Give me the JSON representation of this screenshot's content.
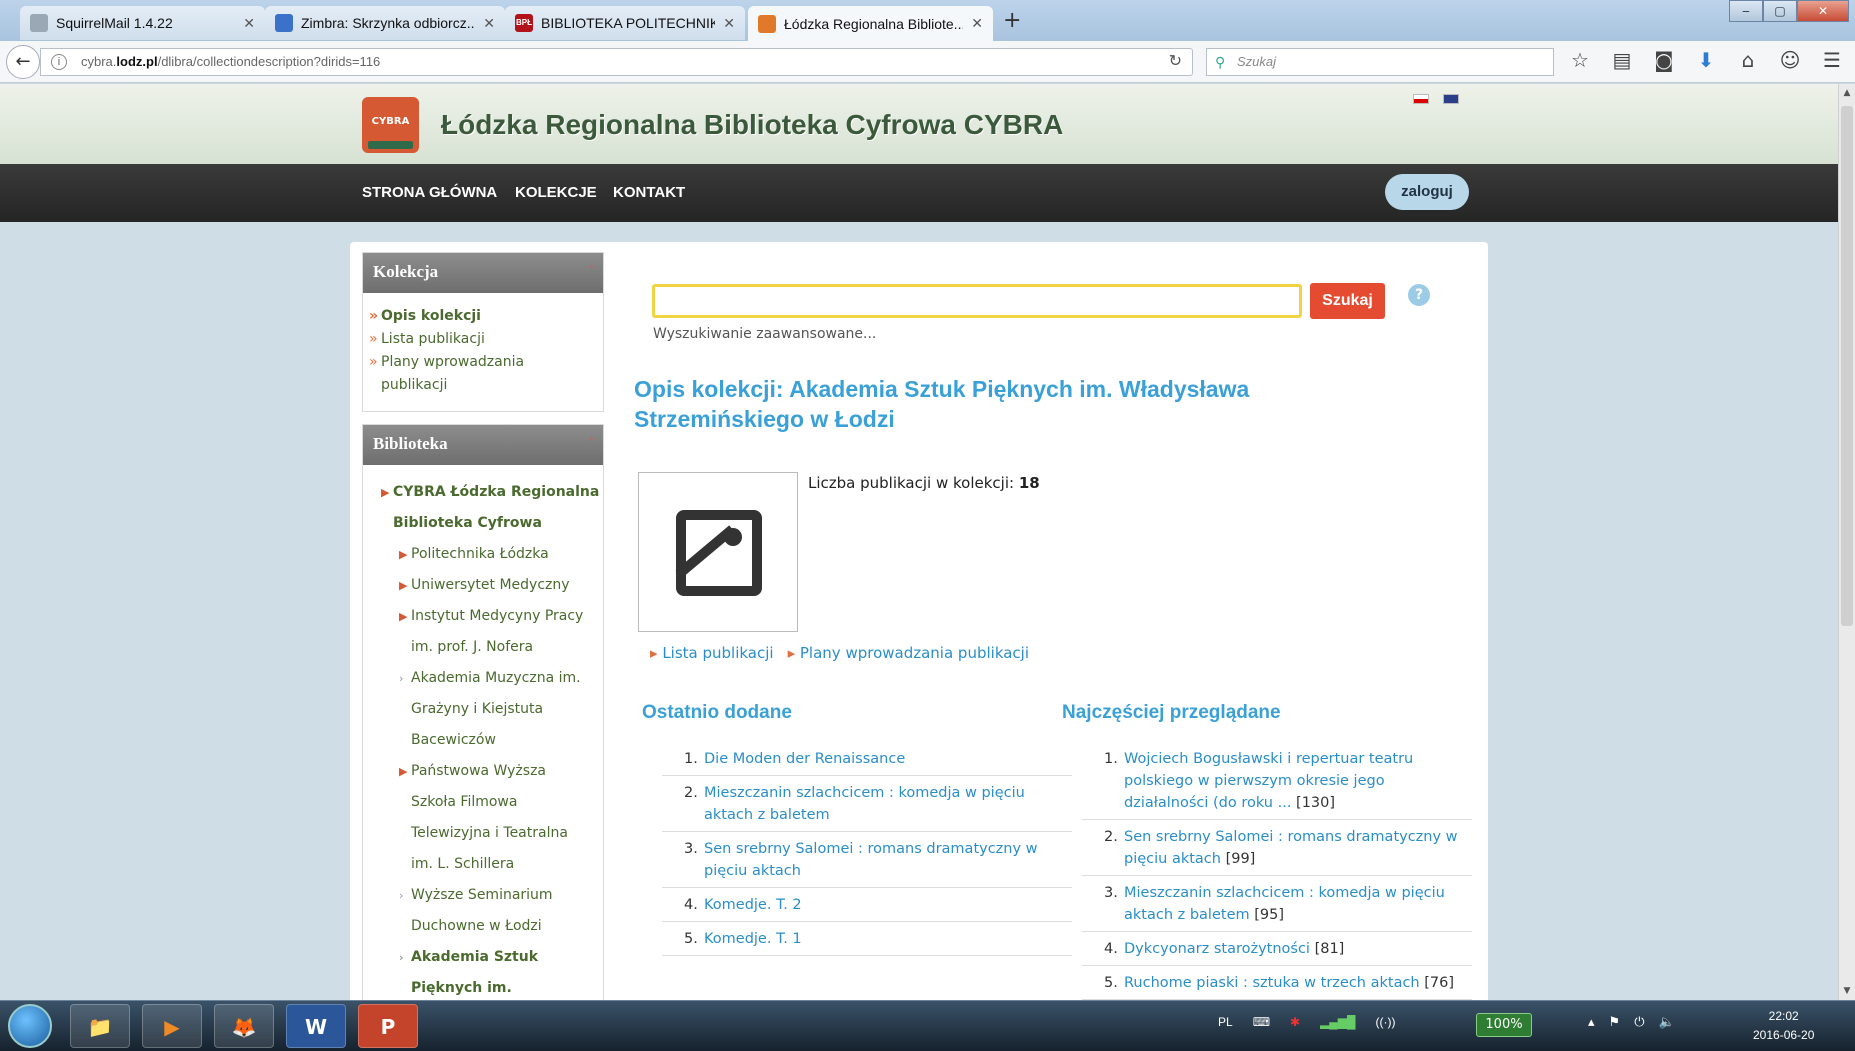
{
  "browser": {
    "tabs": [
      {
        "label": "SquirrelMail 1.4.22",
        "fav_color": "#9aa8b6"
      },
      {
        "label": "Zimbra: Skrzynka odbiorcz...",
        "fav_color": "#3a72c9"
      },
      {
        "label": "BIBLIOTEKA POLITECHNIKI...",
        "fav_color": "#b2121a",
        "fav_text": "BPŁ"
      },
      {
        "label": "Łódzka Regionalna Bibliote...",
        "fav_color": "#e07a2a"
      }
    ],
    "url_prefix": "cybra.",
    "url_domain": "lodz.pl",
    "url_path": "/dlibra/collectiondescription?dirids=116",
    "search_placeholder": "Szukaj",
    "window_buttons": [
      "‒",
      "▢",
      "✕"
    ]
  },
  "header": {
    "logo_text": "CYBRA",
    "title": "Łódzka Regionalna Biblioteka Cyfrowa CYBRA"
  },
  "menu": {
    "items": [
      "STRONA GŁÓWNA",
      "KOLEKCJE",
      "KONTAKT"
    ],
    "login": "zaloguj"
  },
  "sidebar": {
    "kolekcja": {
      "title": "Kolekcja",
      "links": [
        "Opis kolekcji",
        "Lista publikacji",
        "Plany wprowadzania",
        "publikacji"
      ]
    },
    "biblioteka": {
      "title": "Biblioteka",
      "tree": [
        "CYBRA Łódzka Regionalna",
        "Biblioteka Cyfrowa",
        "Politechnika Łódzka",
        "Uniwersytet Medyczny",
        "Instytut Medycyny Pracy",
        "im. prof. J. Nofera",
        "Akademia Muzyczna im.",
        "Grażyny i Kiejstuta",
        "Bacewiczów",
        "Państwowa Wyższa",
        "Szkoła Filmowa",
        "Telewizyjna i Teatralna",
        "im. L. Schillera",
        "Wyższe Seminarium",
        "Duchowne w Łodzi",
        "Akademia Sztuk",
        "Pięknych im."
      ]
    }
  },
  "main": {
    "search_button": "Szukaj",
    "help": "?",
    "advanced": "Wyszukiwanie zaawansowane...",
    "title_line1": "Opis kolekcji: Akademia Sztuk Pięknych im. Władysława",
    "title_line2": "Strzemińskiego w Łodzi",
    "count_label": "Liczba publikacji w kolekcji: ",
    "count_value": "18",
    "links": [
      "Lista publikacji",
      "Plany wprowadzania publikacji"
    ],
    "recent": {
      "title": "Ostatnio dodane",
      "items": [
        {
          "num": "1.",
          "text": "Die Moden der Renaissance"
        },
        {
          "num": "2.",
          "text": "Mieszczanin szlachcicem : komedja w pięciu aktach z baletem"
        },
        {
          "num": "3.",
          "text": "Sen srebrny Salomei : romans dramatyczny w pięciu aktach"
        },
        {
          "num": "4.",
          "text": "Komedje. T. 2"
        },
        {
          "num": "5.",
          "text": "Komedje. T. 1"
        }
      ]
    },
    "popular": {
      "title": "Najczęściej przeglądane",
      "items": [
        {
          "num": "1.",
          "text": "Wojciech Bogusławski i repertuar teatru polskiego w pierwszym okresie jego działalności (do roku ...",
          "count": "[130]"
        },
        {
          "num": "2.",
          "text": "Sen srebrny Salomei : romans dramatyczny w pięciu aktach",
          "count": "[99]"
        },
        {
          "num": "3.",
          "text": "Mieszczanin szlachcicem : komedja w pięciu aktach z baletem",
          "count": "[95]"
        },
        {
          "num": "4.",
          "text": "Dykcyonarz starożytności",
          "count": "[81]"
        },
        {
          "num": "5.",
          "text": "Ruchome piaski : sztuka w trzech aktach",
          "count": "[76]"
        }
      ]
    }
  },
  "taskbar": {
    "apps": [
      "📁",
      "▶",
      "🦊",
      "W",
      "P"
    ],
    "lang": "PL",
    "battery": "100%",
    "time": "22:02",
    "date": "2016-06-20"
  }
}
